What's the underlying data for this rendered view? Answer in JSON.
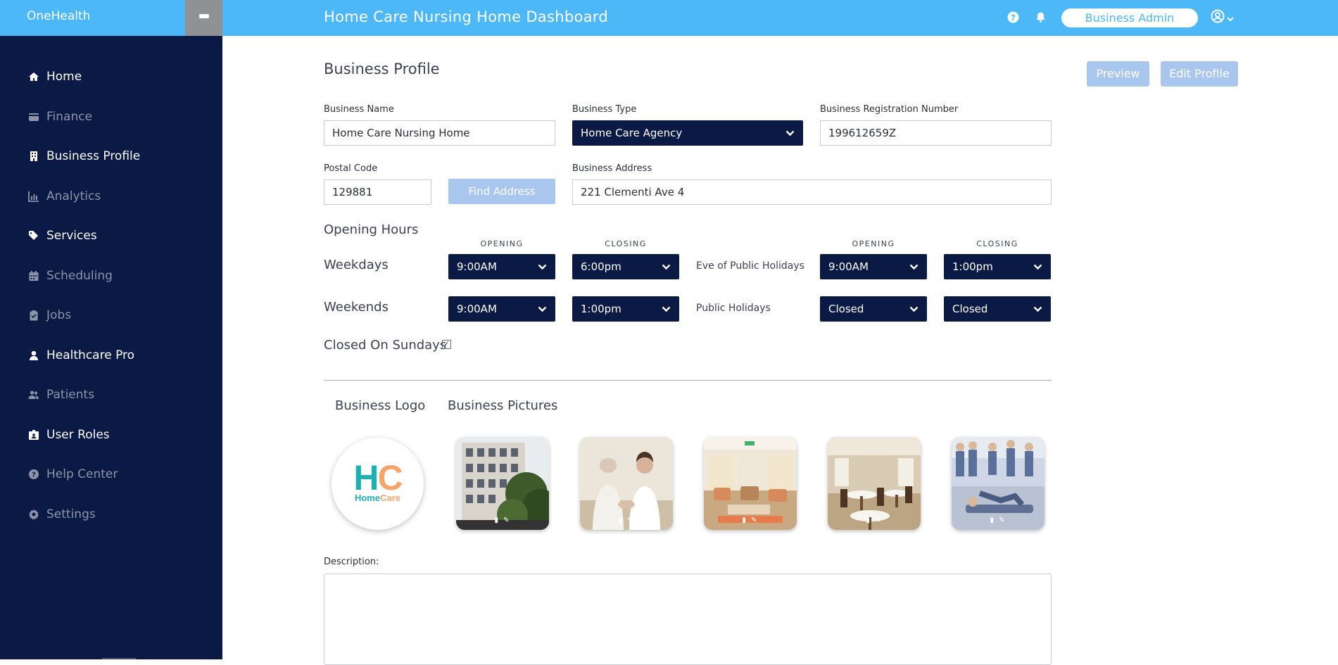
{
  "app": {
    "brand": "OneHealth",
    "dashboard_title": "Home Care Nursing Home Dashboard",
    "role": "Business Admin"
  },
  "icons": {
    "menu": "hamburger-icon",
    "help": "help-circle-icon",
    "notifications": "bell-icon",
    "user": "user-circle-icon",
    "user_caret": "chevron-down-icon"
  },
  "sidebar": {
    "items": [
      {
        "label": "Home",
        "icon": "home-icon",
        "state": "lit"
      },
      {
        "label": "Finance",
        "icon": "wallet-icon",
        "state": "dim"
      },
      {
        "label": "Business Profile",
        "icon": "building-icon",
        "state": "lit"
      },
      {
        "label": "Analytics",
        "icon": "bar-chart-icon",
        "state": "dim"
      },
      {
        "label": "Services",
        "icon": "tags-icon",
        "state": "lit"
      },
      {
        "label": "Scheduling",
        "icon": "calendar-icon",
        "state": "dim"
      },
      {
        "label": "Jobs",
        "icon": "clipboard-check-icon",
        "state": "dim"
      },
      {
        "label": "Healthcare Pro",
        "icon": "user-nurse-icon",
        "state": "lit"
      },
      {
        "label": "Patients",
        "icon": "users-icon",
        "state": "dim"
      },
      {
        "label": "User Roles",
        "icon": "id-badge-icon",
        "state": "lit"
      },
      {
        "label": "Help Center",
        "icon": "question-circle-icon",
        "state": "dim"
      },
      {
        "label": "Settings",
        "icon": "gear-icon",
        "state": "dim"
      }
    ]
  },
  "profile": {
    "title": "Business Profile",
    "preview_label": "Preview",
    "edit_label": "Edit Profile",
    "business_name": {
      "label": "Business Name",
      "value": "Home Care Nursing Home"
    },
    "business_type": {
      "label": "Business Type",
      "value": "Home Care Agency"
    },
    "registration": {
      "label": "Business Registration Number",
      "value": "199612659Z"
    },
    "postal": {
      "label": "Postal Code",
      "value": "129881"
    },
    "find_address_label": "Find Address",
    "address": {
      "label": "Business Address",
      "value": "221 Clementi Ave 4"
    }
  },
  "hours": {
    "title": "Opening Hours",
    "opening_label": "OPENING",
    "closing_label": "CLOSING",
    "weekdays": {
      "label": "Weekdays",
      "open": "9:00AM",
      "close": "6:00pm"
    },
    "weekends": {
      "label": "Weekends",
      "open": "9:00AM",
      "close": "1:00pm"
    },
    "eve_holidays": {
      "label": "Eve of Public Holidays",
      "open": "9:00AM",
      "close": "1:00pm"
    },
    "public_holidays": {
      "label": "Public Holidays",
      "open": "Closed",
      "close": "Closed"
    },
    "closed_sundays": {
      "label": "Closed On Sundays",
      "checked": true
    }
  },
  "media": {
    "logo_title": "Business Logo",
    "pictures_title": "Business Pictures",
    "logo_text_big_h": "H",
    "logo_text_big_c": "C",
    "logo_text_small_a": "Home",
    "logo_text_small_b": "Care",
    "pictures": [
      {
        "name": "building-photo"
      },
      {
        "name": "caregiver-photo"
      },
      {
        "name": "lounge-photo"
      },
      {
        "name": "dining-hall-photo"
      },
      {
        "name": "training-photo"
      }
    ]
  },
  "description": {
    "label": "Description:",
    "value": ""
  }
}
